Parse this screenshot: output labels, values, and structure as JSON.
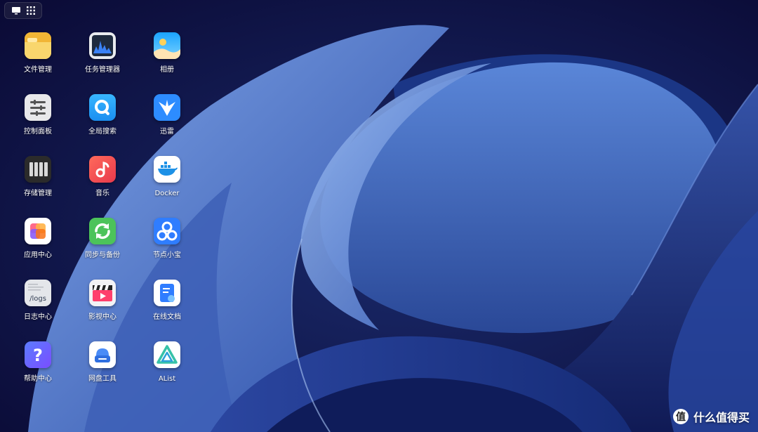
{
  "desktop": {
    "apps": [
      {
        "id": "file-manager",
        "label": "文件管理"
      },
      {
        "id": "task-manager",
        "label": "任务管理器"
      },
      {
        "id": "photos",
        "label": "相册"
      },
      {
        "id": "control-panel",
        "label": "控制面板"
      },
      {
        "id": "global-search",
        "label": "全局搜索"
      },
      {
        "id": "thunder",
        "label": "迅雷"
      },
      {
        "id": "storage-manager",
        "label": "存储管理"
      },
      {
        "id": "music",
        "label": "音乐"
      },
      {
        "id": "docker",
        "label": "Docker"
      },
      {
        "id": "app-center",
        "label": "应用中心"
      },
      {
        "id": "sync-backup",
        "label": "同步与备份"
      },
      {
        "id": "node-treasure",
        "label": "节点小宝"
      },
      {
        "id": "log-center",
        "label": "日志中心"
      },
      {
        "id": "media-center",
        "label": "影视中心"
      },
      {
        "id": "online-docs",
        "label": "在线文档"
      },
      {
        "id": "help-center",
        "label": "帮助中心"
      },
      {
        "id": "netdisk-tools",
        "label": "网盘工具"
      },
      {
        "id": "alist",
        "label": "AList"
      }
    ],
    "log_icon_text": "/logs"
  },
  "watermark": {
    "text": "什么值得买"
  },
  "colors": {
    "background": "#0c0b36",
    "accent": "#3a6fd8"
  }
}
